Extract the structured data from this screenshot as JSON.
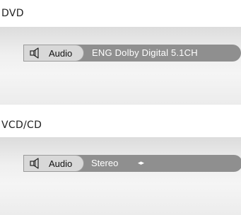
{
  "sections": [
    {
      "title": "DVD",
      "audio_label": "Audio",
      "audio_value": "ENG Dolby  Digital  5.1CH"
    },
    {
      "title": "VCD/CD",
      "audio_label": "Audio",
      "audio_value": "Stereo",
      "arrows": "◂▸"
    }
  ],
  "icons": {
    "speaker": "speaker-icon"
  },
  "colors": {
    "bar": "#8f8f8f",
    "pill": "#d8d8d8",
    "value_text": "#ffffff"
  }
}
